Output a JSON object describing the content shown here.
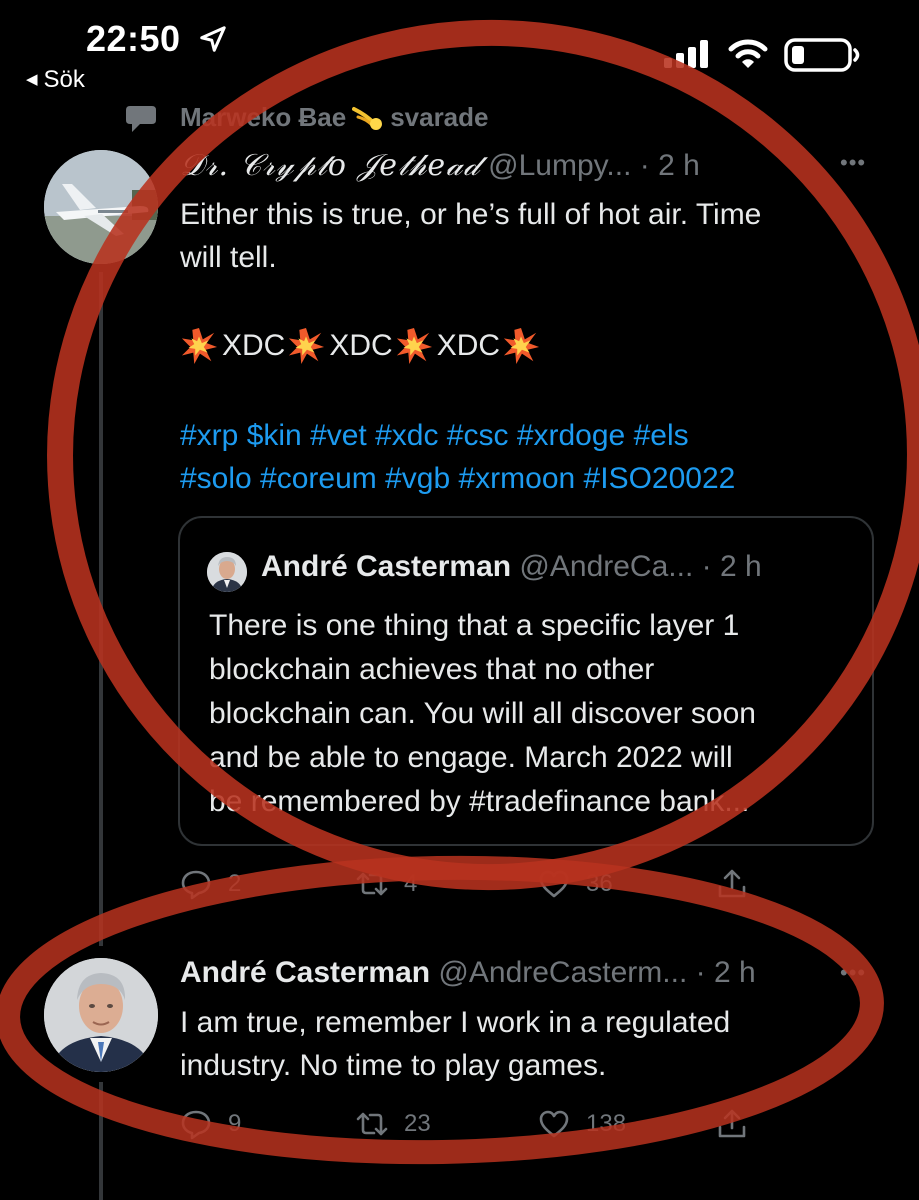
{
  "status_bar": {
    "time": "22:50",
    "back_label": "Sök"
  },
  "context": {
    "replier": "Marweko Ƀae",
    "action": "svarade"
  },
  "tweet1": {
    "display_name": "𝒟𝓇. 𝒞𝓇𝓎𝓅𝓉𝑜 𝒥𝑒𝓉𝒽𝑒𝒶𝒹",
    "handle": "@Lumpy...",
    "time": "· 2 h",
    "text_line1": "Either this is true, or he’s full of hot air. Time",
    "text_line2": "will tell.",
    "xdc_words": [
      "XDC",
      "XDC",
      "XDC"
    ],
    "hashtags_line1": "#xrp $kin #vet #xdc #csc #xrdoge #els",
    "hashtags_line2": "#solo #coreum #vgb #xrmoon #ISO20022",
    "stats": {
      "replies": "2",
      "retweets": "4",
      "likes": "36"
    }
  },
  "quote": {
    "display_name": "André Casterman",
    "handle": "@AndreCa...",
    "time": "· 2 h",
    "lines": [
      "There is one thing that a specific layer 1",
      "blockchain achieves that no other",
      "blockchain can. You will all discover soon",
      "and be able to engage. March 2022 will",
      "be remembered by #tradefinance bank..."
    ]
  },
  "tweet2": {
    "display_name": "André Casterman",
    "handle": "@AndreCasterm...",
    "time": "· 2 h",
    "text_line1": "I am true, remember I work in a regulated",
    "text_line2": "industry. No time to play games.",
    "stats": {
      "replies": "9",
      "retweets": "23",
      "likes": "138"
    }
  },
  "colors": {
    "background": "#000000",
    "link": "#1d9bf0",
    "muted": "#71767b",
    "annotation": "#b8321f"
  }
}
